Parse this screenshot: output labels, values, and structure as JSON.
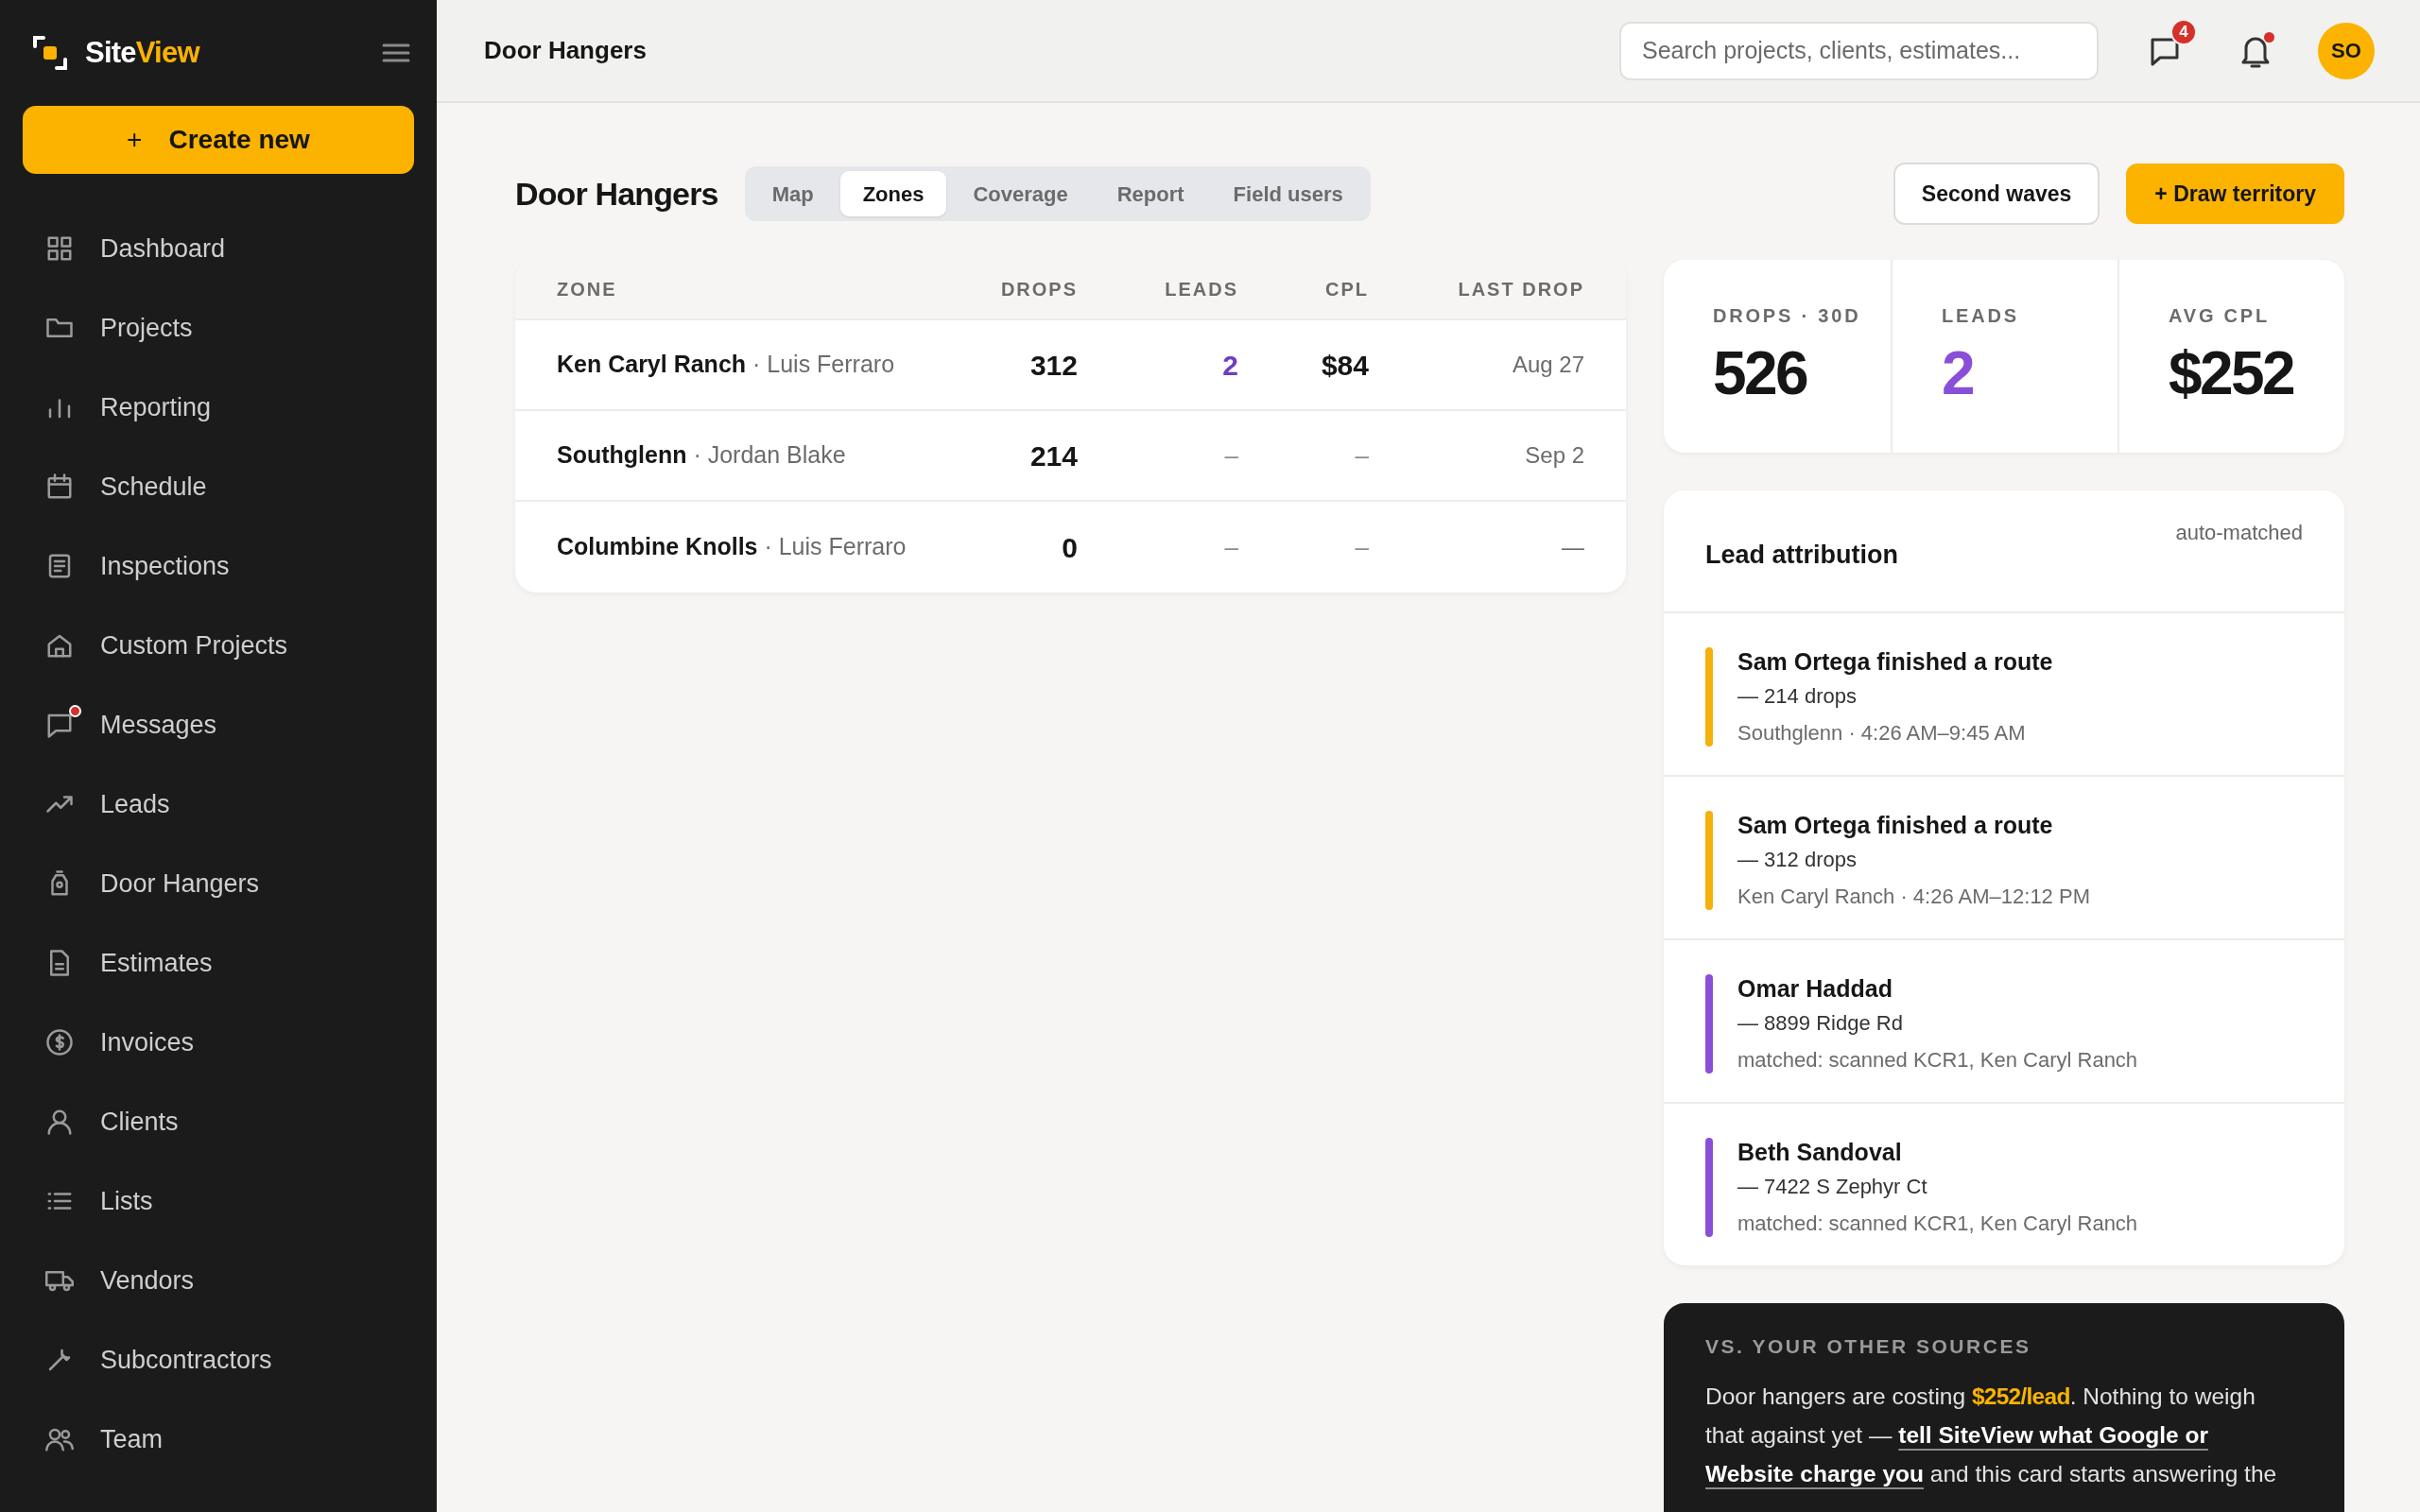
{
  "sidebar": {
    "logo": {
      "first": "Site",
      "second": "View"
    },
    "create_button": {
      "icon": "+",
      "label": "Create new"
    },
    "items": [
      {
        "label": "Dashboard",
        "unread": false
      },
      {
        "label": "Projects",
        "unread": false
      },
      {
        "label": "Reporting",
        "unread": false
      },
      {
        "label": "Schedule",
        "unread": false
      },
      {
        "label": "Inspections",
        "unread": false
      },
      {
        "label": "Custom Projects",
        "unread": false
      },
      {
        "label": "Messages",
        "unread": true
      },
      {
        "label": "Leads",
        "unread": false
      },
      {
        "label": "Door Hangers",
        "unread": false
      },
      {
        "label": "Estimates",
        "unread": false
      },
      {
        "label": "Invoices",
        "unread": false
      },
      {
        "label": "Clients",
        "unread": false
      },
      {
        "label": "Lists",
        "unread": false
      },
      {
        "label": "Vendors",
        "unread": false
      },
      {
        "label": "Subcontractors",
        "unread": false
      },
      {
        "label": "Team",
        "unread": false
      }
    ]
  },
  "header": {
    "title": "Door Hangers",
    "search": {
      "placeholder": "Search projects, clients, estimates..."
    },
    "messages_badge": "4",
    "notifications_unread": true,
    "avatar": "SO"
  },
  "page": {
    "title": "Door Hangers",
    "tabs": [
      {
        "label": "Map",
        "selected": false
      },
      {
        "label": "Zones",
        "selected": true
      },
      {
        "label": "Coverage",
        "selected": false
      },
      {
        "label": "Report",
        "selected": false
      },
      {
        "label": "Field users",
        "selected": false
      }
    ],
    "buttons": [
      {
        "kind": "secondary",
        "label": "Second waves"
      },
      {
        "kind": "primary",
        "label": "+ Draw territory"
      }
    ]
  },
  "table": {
    "columns": [
      "ZONE",
      "DROPS",
      "LEADS",
      "CPL",
      "LAST DROP"
    ],
    "rows": [
      {
        "zone": "Ken Caryl Ranch",
        "owner": "· Luis Ferraro",
        "drops": "312",
        "leads": "2",
        "cpl": "$84",
        "last_drop": "Aug 27",
        "has_leads": true
      },
      {
        "zone": "Southglenn",
        "owner": "· Jordan Blake",
        "drops": "214",
        "leads": "–",
        "cpl": "–",
        "last_drop": "Sep 2",
        "has_leads": false
      },
      {
        "zone": "Columbine Knolls",
        "owner": "· Luis Ferraro",
        "drops": "0",
        "leads": "–",
        "cpl": "–",
        "last_drop": "—",
        "has_leads": false
      }
    ]
  },
  "stats": [
    {
      "label": "DROPS · 30D",
      "value": "526",
      "color": "#161616"
    },
    {
      "label": "LEADS",
      "value": "2",
      "color": "#8a4fd8"
    },
    {
      "label": "AVG CPL",
      "value": "$252",
      "color": "#161616"
    }
  ],
  "lead_attribution": {
    "title": "Lead attribution",
    "note": "auto-matched",
    "items": [
      {
        "title": "Sam Ortega finished a route",
        "detail": "— 214 drops",
        "meta": "Southglenn · 4:26 AM–9:45 AM",
        "color": "#f5b00a"
      },
      {
        "title": "Sam Ortega finished a route",
        "detail": "— 312 drops",
        "meta": "Ken Caryl Ranch · 4:26 AM–12:12 PM",
        "color": "#f5b00a"
      },
      {
        "title": "Omar Haddad",
        "detail": "— 8899 Ridge Rd",
        "meta": "matched: scanned KCR1, Ken Caryl Ranch",
        "color": "#8a4fd8"
      },
      {
        "title": "Beth Sandoval",
        "detail": "— 7422 S Zephyr Ct",
        "meta": "matched: scanned KCR1, Ken Caryl Ranch",
        "color": "#8a4fd8"
      }
    ]
  },
  "sources_card": {
    "title": "VS. YOUR OTHER SOURCES",
    "lines": [
      [
        {
          "kind": "plain",
          "text": "Door hangers are costing "
        },
        {
          "kind": "highlight",
          "text": "$252/lead"
        },
        {
          "kind": "plain",
          "text": ". Nothing to weigh"
        }
      ],
      [
        {
          "kind": "plain",
          "text": "that against yet — "
        },
        {
          "kind": "link",
          "text": "tell SiteView what Google or"
        }
      ],
      [
        {
          "kind": "link",
          "text": "Website charge you"
        },
        {
          "kind": "plain",
          "text": " and this card starts answering the"
        }
      ]
    ]
  }
}
